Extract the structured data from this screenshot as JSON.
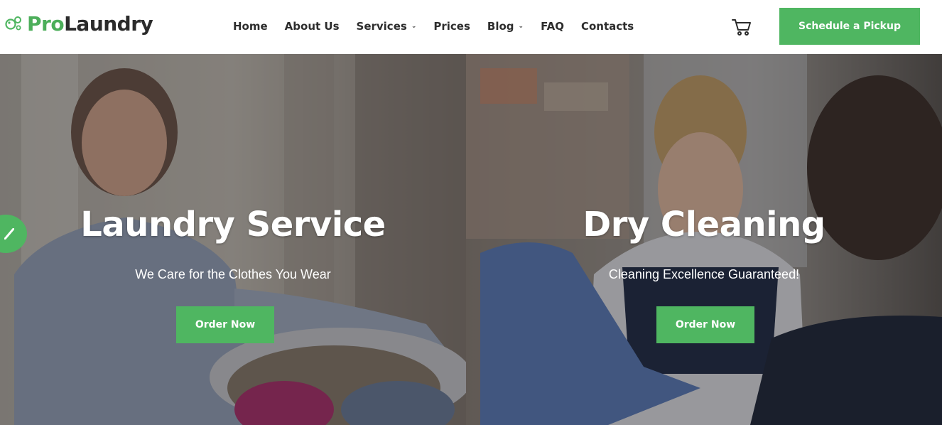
{
  "brand": {
    "name_part1": "Pro",
    "name_part2": "Laundry",
    "accent_color": "#4fb661",
    "icon": "bubbles-logo-icon"
  },
  "nav": {
    "items": [
      {
        "label": "Home",
        "has_dropdown": false
      },
      {
        "label": "About Us",
        "has_dropdown": false
      },
      {
        "label": "Services",
        "has_dropdown": true
      },
      {
        "label": "Prices",
        "has_dropdown": false
      },
      {
        "label": "Blog",
        "has_dropdown": true
      },
      {
        "label": "FAQ",
        "has_dropdown": false
      },
      {
        "label": "Contacts",
        "has_dropdown": false
      }
    ],
    "caret": "⌄"
  },
  "header": {
    "cart_icon": "cart-icon",
    "cta_label": "Schedule a Pickup"
  },
  "hero": {
    "left": {
      "title": "Laundry Service",
      "subtitle": "We Care for the Clothes You Wear",
      "button": "Order Now"
    },
    "right": {
      "title": "Dry Cleaning",
      "subtitle": "Cleaning Excellence Guaranteed!",
      "button": "Order Now"
    },
    "side_badge_icon": "check-icon"
  }
}
